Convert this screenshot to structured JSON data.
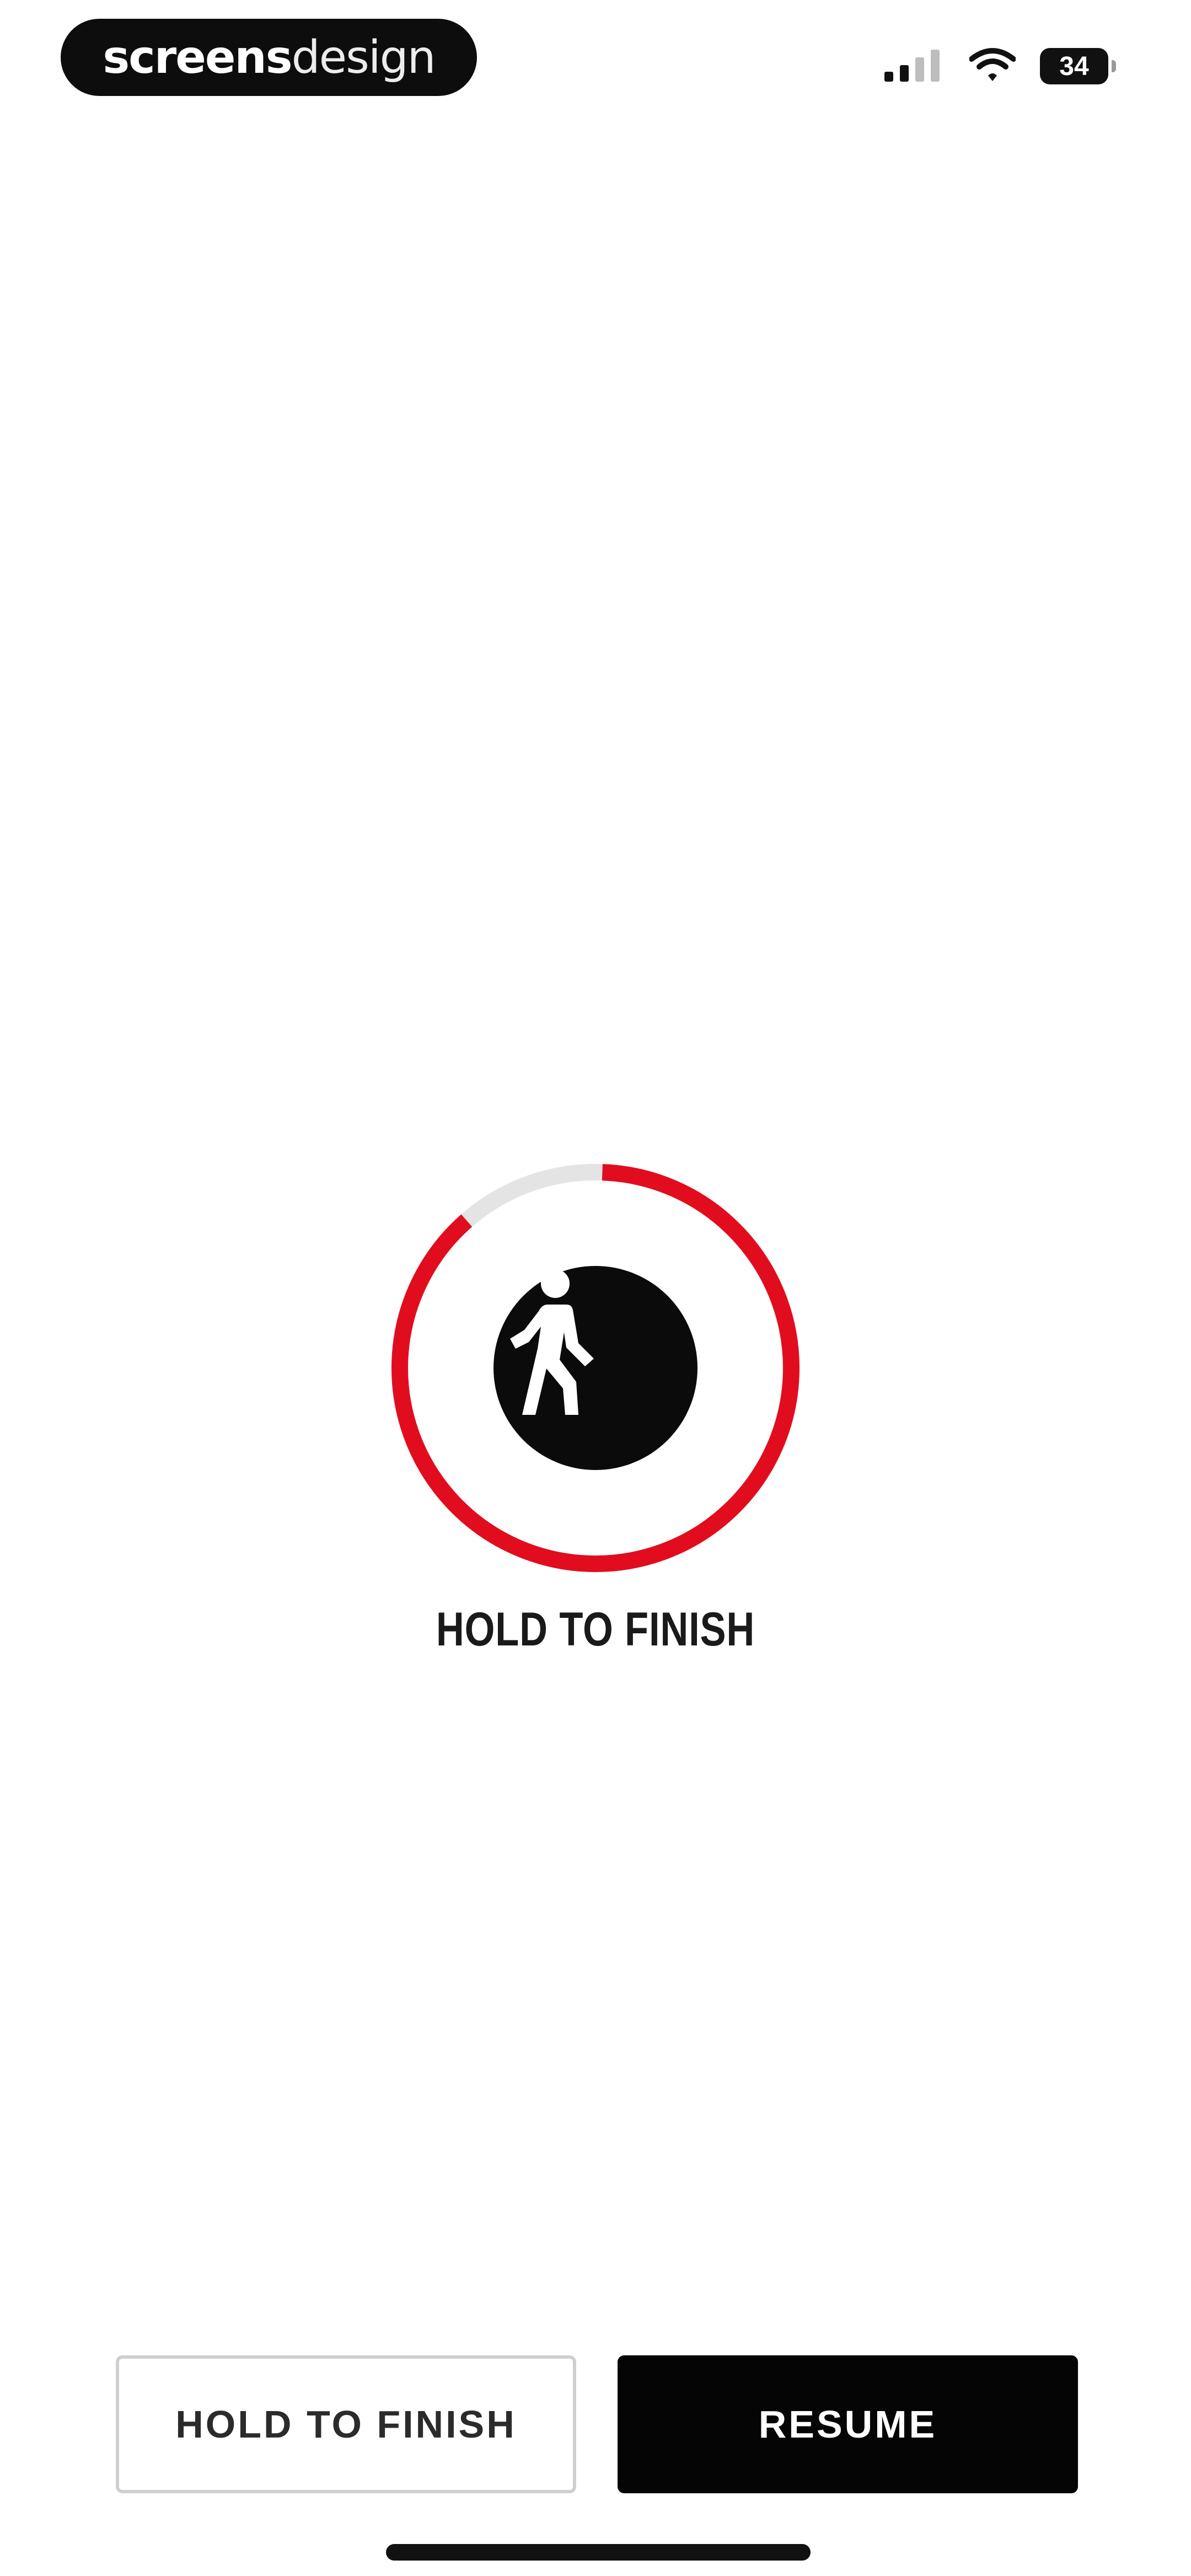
{
  "status_bar": {
    "brand_bold": "screens",
    "brand_light": "design",
    "battery_level": "34",
    "signal_icon": "cellular-signal-icon",
    "wifi_icon": "wifi-icon",
    "battery_icon": "battery-icon"
  },
  "progress": {
    "label": "HOLD TO FINISH",
    "fraction": 0.88,
    "icon": "walking-person-icon",
    "accent_color": "#e10d1f",
    "track_color": "#e4e4e4"
  },
  "buttons": {
    "hold_label": "HOLD TO FINISH",
    "resume_label": "RESUME"
  },
  "colors": {
    "background": "#ffffff",
    "primary": "#050505",
    "accent": "#e10d1f"
  }
}
